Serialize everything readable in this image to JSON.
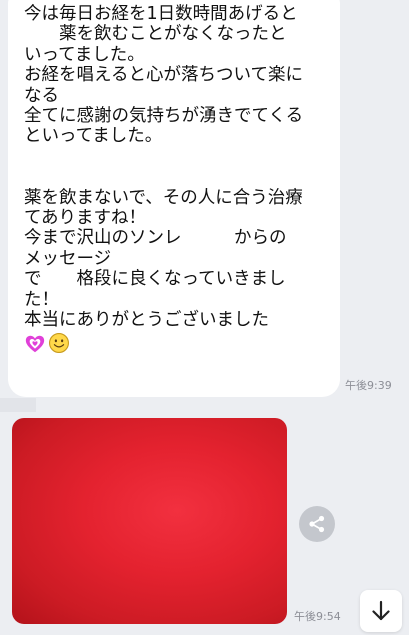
{
  "message": {
    "lines": [
      "今は毎日お経を1日数時間あげると",
      "　　薬を飲むことがなくなったと",
      "いってました。",
      "お経を唱えると心が落ちついて楽に",
      "なる",
      "全てに感謝の気持ちが湧きでてくる",
      "といってました。",
      "",
      "",
      "薬を飲まないで、その人に合う治療",
      "てありますね！",
      "今まで沢山のソンレ　　　からの",
      "メッセージ",
      "で　　格段に良くなっていきまし",
      "た！",
      "本当にありがとうございました"
    ],
    "emojis": [
      "sparkling-heart-icon",
      "smiling-face-icon"
    ],
    "time": "午後9:39"
  },
  "photo_message": {
    "color": "#e4222f",
    "time": "午後9:54"
  },
  "controls": {
    "share_icon": "share-icon",
    "scroll_icon": "arrow-down-icon"
  },
  "colors": {
    "background": "#eceef2",
    "bubble": "#ffffff",
    "timestamp": "#8c8e96",
    "heart": "#e040d8"
  }
}
